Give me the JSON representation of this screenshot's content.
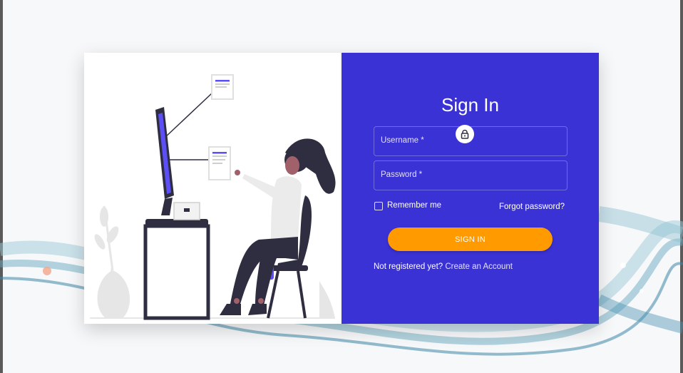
{
  "form": {
    "title": "Sign In",
    "username_label": "Username *",
    "password_label": "Password *",
    "remember_label": "Remember me",
    "forgot_label": "Forgot password?",
    "signin_label": "SIGN IN",
    "not_registered": "Not registered yet?",
    "create_account": "Create an Account"
  },
  "icons": {
    "lock": "lock-icon"
  },
  "colors": {
    "panel": "#3b32d6",
    "button": "#ff9a00",
    "illustration_accent": "#5b4ff5",
    "illustration_dark": "#2f2e41"
  }
}
